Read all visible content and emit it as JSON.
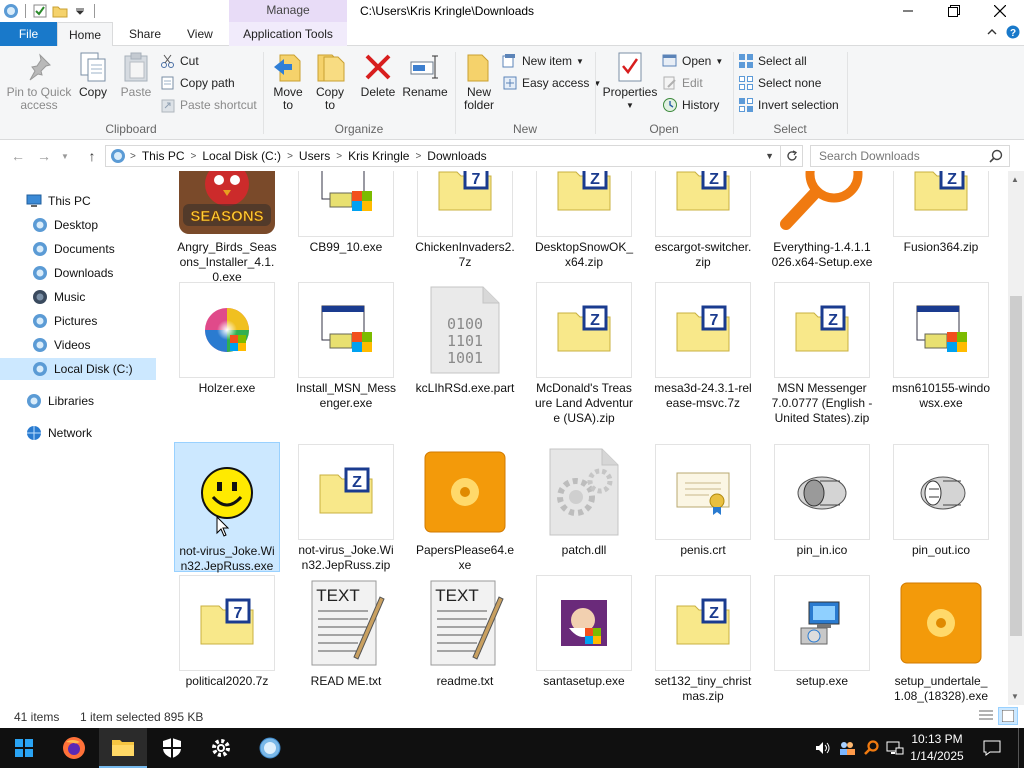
{
  "window": {
    "path_title": "C:\\Users\\Kris Kringle\\Downloads",
    "manage_label": "Manage"
  },
  "tabs": {
    "file": "File",
    "home": "Home",
    "share": "Share",
    "view": "View",
    "app_tools": "Application Tools"
  },
  "ribbon": {
    "clipboard": {
      "label": "Clipboard",
      "pin": "Pin to Quick access",
      "copy": "Copy",
      "paste": "Paste",
      "cut": "Cut",
      "copy_path": "Copy path",
      "paste_shortcut": "Paste shortcut"
    },
    "organize": {
      "label": "Organize",
      "move_to": "Move to",
      "copy_to": "Copy to",
      "delete": "Delete",
      "rename": "Rename"
    },
    "new": {
      "label": "New",
      "new_folder": "New folder",
      "new_item": "New item",
      "easy_access": "Easy access"
    },
    "open": {
      "label": "Open",
      "properties": "Properties",
      "open": "Open",
      "edit": "Edit",
      "history": "History"
    },
    "select": {
      "label": "Select",
      "select_all": "Select all",
      "select_none": "Select none",
      "invert": "Invert selection"
    }
  },
  "address": {
    "crumbs": [
      "This PC",
      "Local Disk (C:)",
      "Users",
      "Kris Kringle",
      "Downloads"
    ],
    "search_placeholder": "Search Downloads"
  },
  "nav": {
    "this_pc": "This PC",
    "desktop": "Desktop",
    "documents": "Documents",
    "downloads": "Downloads",
    "music": "Music",
    "pictures": "Pictures",
    "videos": "Videos",
    "local_disk": "Local Disk (C:)",
    "libraries": "Libraries",
    "network": "Network"
  },
  "files": [
    {
      "name": "Angry_Birds_Seasons_Installer_4.1.0.exe",
      "icon": "angry-birds-seasons-icon",
      "badge": "SEASONS"
    },
    {
      "name": "CB99_10.exe",
      "icon": "installer-icon"
    },
    {
      "name": "ChickenInvaders2.7z",
      "icon": "7z-archive-icon"
    },
    {
      "name": "DesktopSnowOK_x64.zip",
      "icon": "zip-archive-icon"
    },
    {
      "name": "escargot-switcher.zip",
      "icon": "zip-archive-icon"
    },
    {
      "name": "Everything-1.4.1.1026.x64-Setup.exe",
      "icon": "everything-magnifier-icon"
    },
    {
      "name": "Fusion364.zip",
      "icon": "zip-archive-icon"
    },
    {
      "name": "Holzer.exe",
      "icon": "color-wheel-icon"
    },
    {
      "name": "Install_MSN_Messenger.exe",
      "icon": "installer-icon"
    },
    {
      "name": "kcLIhRSd.exe.part",
      "icon": "binary-file-icon",
      "binary_lines": [
        "0100",
        "1101",
        "1001"
      ]
    },
    {
      "name": "McDonald's Treasure Land Adventure (USA).zip",
      "icon": "zip-archive-icon"
    },
    {
      "name": "mesa3d-24.3.1-release-msvc.7z",
      "icon": "7z-archive-icon"
    },
    {
      "name": "MSN Messenger 7.0.0777 (English - United States).zip",
      "icon": "zip-archive-icon"
    },
    {
      "name": "msn610155-windowsx.exe",
      "icon": "installer-icon"
    },
    {
      "name": "not-virus_Joke.Win32.JepRuss.exe",
      "icon": "smiley-face-icon"
    },
    {
      "name": "not-virus_Joke.Win32.JepRuss.zip",
      "icon": "zip-archive-icon"
    },
    {
      "name": "PapersPlease64.exe",
      "icon": "orange-disc-icon"
    },
    {
      "name": "patch.dll",
      "icon": "dll-gear-icon"
    },
    {
      "name": "penis.crt",
      "icon": "certificate-icon"
    },
    {
      "name": "pin_in.ico",
      "icon": "pin-in-icon"
    },
    {
      "name": "pin_out.ico",
      "icon": "pin-out-icon"
    },
    {
      "name": "political2020.7z",
      "icon": "7z-archive-icon"
    },
    {
      "name": "READ ME.txt",
      "icon": "text-document-icon",
      "badge": "TEXT"
    },
    {
      "name": "readme.txt",
      "icon": "text-document-icon",
      "badge": "TEXT"
    },
    {
      "name": "santasetup.exe",
      "icon": "santa-setup-icon"
    },
    {
      "name": "set132_tiny_christmas.zip",
      "icon": "zip-archive-icon"
    },
    {
      "name": "setup.exe",
      "icon": "setup-computer-icon"
    },
    {
      "name": "setup_undertale_1.08_(18328).exe",
      "icon": "orange-disc-icon"
    }
  ],
  "status": {
    "items": "41 items",
    "selected": "1 item selected",
    "size": "895 KB"
  },
  "taskbar": {
    "time": "10:13 PM",
    "date": "1/14/2025"
  },
  "colors": {
    "accent": "#1979ca",
    "selection": "#cce8ff",
    "manage_tab": "#e8dcf7",
    "taskbar": "#101010"
  }
}
